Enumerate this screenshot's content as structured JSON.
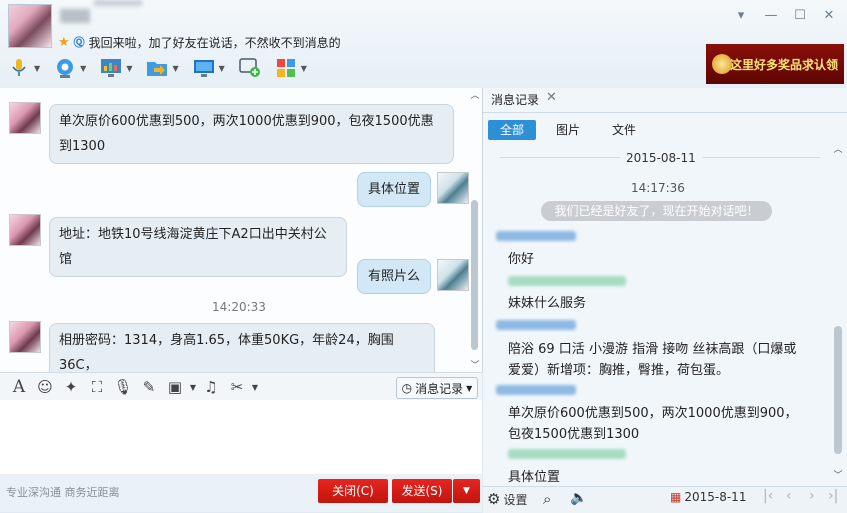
{
  "header": {
    "status_message": "我回来啦，加了好友在说话，不然收不到消息的",
    "ad_text": "这里好多奖品求认领"
  },
  "toolbar": {
    "items": [
      "microphone-icon",
      "video-camera-icon",
      "screen-share-icon",
      "file-transfer-icon",
      "remote-assist-icon",
      "add-chat-icon",
      "apps-icon"
    ]
  },
  "chat": {
    "messages": [
      {
        "text": "单次原价600优惠到500，两次1000优惠到900，包夜1500优惠到1300"
      },
      {
        "text": "具体位置"
      },
      {
        "text": "地址：地铁10号线海淀黄庄下A2口出中关村公馆"
      },
      {
        "text": "有照片么"
      },
      {
        "text": "相册密码：1314，身高1.65，体重50KG，年龄24，胸围36C，"
      }
    ],
    "time": "14:20:33"
  },
  "input_toolbar": {
    "history_label": "消息记录"
  },
  "footer": {
    "slogan": "专业深沟通 商务近距离",
    "close_label": "关闭(C)",
    "send_label": "发送(S)"
  },
  "history": {
    "tab_label": "消息记录",
    "filters": [
      "全部",
      "图片",
      "文件"
    ],
    "date": "2015-08-11",
    "time": "14:17:36",
    "system_note": "我们已经是好友了，现在开始对话吧！",
    "entries": [
      "你好",
      "妹妹什么服务",
      "陪浴 69 口活 小漫游 指滑 接吻  丝袜高跟（口爆或爱爱）新增项：胸推，臀推，荷包蛋。",
      "单次原价600优惠到500，两次1000优惠到900，包夜1500优惠到1300",
      "具体位置"
    ],
    "bottom": {
      "settings_label": "设置",
      "date_label": "2015-8-11"
    }
  },
  "colors": {
    "accent": "#2d8fd8",
    "send_red": "#d81c15",
    "bubble": "#e6eef4"
  }
}
